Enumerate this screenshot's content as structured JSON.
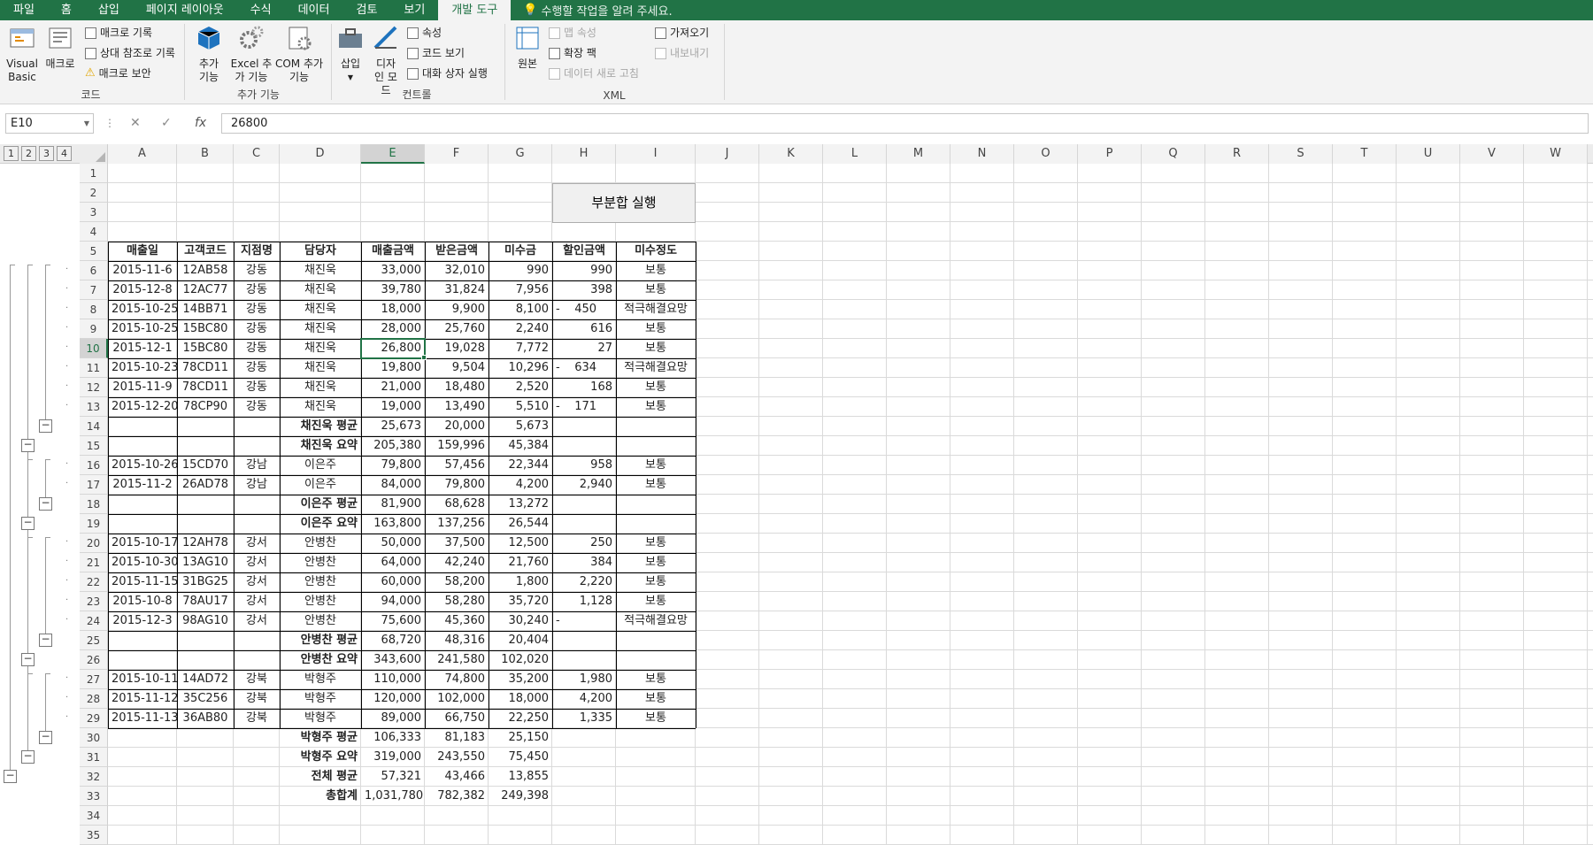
{
  "tabs": [
    "파일",
    "홈",
    "삽입",
    "페이지 레이아웃",
    "수식",
    "데이터",
    "검토",
    "보기",
    "개발 도구"
  ],
  "active_tab": "개발 도구",
  "tell_me": "수행할 작업을 알려 주세요.",
  "ribbon": {
    "code": {
      "label": "코드",
      "visual_basic": "Visual Basic",
      "macro": "매크로",
      "record_macro": "매크로 기록",
      "relative_ref": "상대 참조로 기록",
      "macro_security": "매크로 보안"
    },
    "addins": {
      "label": "추가 기능",
      "addins": "추가 기능",
      "excel_addins": "Excel 추가 기능",
      "com_addins": "COM 추가 기능"
    },
    "controls": {
      "label": "컨트롤",
      "insert": "삽입",
      "design_mode": "디자인 모드",
      "properties": "속성",
      "view_code": "코드 보기",
      "run_dialog": "대화 상자 실행"
    },
    "xml": {
      "label": "XML",
      "source": "원본",
      "map_props": "맵 속성",
      "expansion": "확장 팩",
      "refresh": "데이터 새로 고침",
      "import": "가져오기",
      "export": "내보내기"
    }
  },
  "name_box": "E10",
  "formula": "26800",
  "outline_levels": [
    "1",
    "2",
    "3",
    "4"
  ],
  "columns": [
    "A",
    "B",
    "C",
    "D",
    "E",
    "F",
    "G",
    "H",
    "I",
    "J",
    "K",
    "L",
    "M",
    "N",
    "O",
    "P",
    "Q",
    "R",
    "S",
    "T",
    "U",
    "V",
    "W"
  ],
  "rows": [
    "1",
    "2",
    "3",
    "4",
    "5",
    "6",
    "7",
    "8",
    "9",
    "10",
    "11",
    "12",
    "13",
    "14",
    "15",
    "16",
    "17",
    "18",
    "19",
    "20",
    "21",
    "22",
    "23",
    "24",
    "25",
    "26",
    "27",
    "28",
    "29",
    "30",
    "31",
    "32",
    "33",
    "34",
    "35"
  ],
  "button_label": "부분합 실행",
  "headers": [
    "매출일",
    "고객코드",
    "지점명",
    "담당자",
    "매출금액",
    "받은금액",
    "미수금",
    "할인금액",
    "미수정도"
  ],
  "data": [
    [
      "2015-11-6",
      "12AB58",
      "강동",
      "채진욱",
      "33,000",
      "32,010",
      "990",
      "990",
      "보통"
    ],
    [
      "2015-12-8",
      "12AC77",
      "강동",
      "채진욱",
      "39,780",
      "31,824",
      "7,956",
      "398",
      "보통"
    ],
    [
      "2015-10-25",
      "14BB71",
      "강동",
      "채진욱",
      "18,000",
      "9,900",
      "8,100",
      "-    450",
      "적극해결요망"
    ],
    [
      "2015-10-25",
      "15BC80",
      "강동",
      "채진욱",
      "28,000",
      "25,760",
      "2,240",
      "616",
      "보통"
    ],
    [
      "2015-12-1",
      "15BC80",
      "강동",
      "채진욱",
      "26,800",
      "19,028",
      "7,772",
      "27",
      "보통"
    ],
    [
      "2015-10-23",
      "78CD11",
      "강동",
      "채진욱",
      "19,800",
      "9,504",
      "10,296",
      "-    634",
      "적극해결요망"
    ],
    [
      "2015-11-9",
      "78CD11",
      "강동",
      "채진욱",
      "21,000",
      "18,480",
      "2,520",
      "168",
      "보통"
    ],
    [
      "2015-12-20",
      "78CP90",
      "강동",
      "채진욱",
      "19,000",
      "13,490",
      "5,510",
      "-    171",
      "보통"
    ],
    [
      "",
      "",
      "",
      "채진욱 평균",
      "25,673",
      "20,000",
      "5,673",
      "",
      ""
    ],
    [
      "",
      "",
      "",
      "채진욱 요약",
      "205,380",
      "159,996",
      "45,384",
      "",
      ""
    ],
    [
      "2015-10-26",
      "15CD70",
      "강남",
      "이은주",
      "79,800",
      "57,456",
      "22,344",
      "958",
      "보통"
    ],
    [
      "2015-11-2",
      "26AD78",
      "강남",
      "이은주",
      "84,000",
      "79,800",
      "4,200",
      "2,940",
      "보통"
    ],
    [
      "",
      "",
      "",
      "이은주 평균",
      "81,900",
      "68,628",
      "13,272",
      "",
      ""
    ],
    [
      "",
      "",
      "",
      "이은주 요약",
      "163,800",
      "137,256",
      "26,544",
      "",
      ""
    ],
    [
      "2015-10-17",
      "12AH78",
      "강서",
      "안병찬",
      "50,000",
      "37,500",
      "12,500",
      "250",
      "보통"
    ],
    [
      "2015-10-30",
      "13AG10",
      "강서",
      "안병찬",
      "64,000",
      "42,240",
      "21,760",
      "384",
      "보통"
    ],
    [
      "2015-11-15",
      "31BG25",
      "강서",
      "안병찬",
      "60,000",
      "58,200",
      "1,800",
      "2,220",
      "보통"
    ],
    [
      "2015-10-8",
      "78AU17",
      "강서",
      "안병찬",
      "94,000",
      "58,280",
      "35,720",
      "1,128",
      "보통"
    ],
    [
      "2015-12-3",
      "98AG10",
      "강서",
      "안병찬",
      "75,600",
      "45,360",
      "30,240",
      "-",
      "적극해결요망"
    ],
    [
      "",
      "",
      "",
      "안병찬 평균",
      "68,720",
      "48,316",
      "20,404",
      "",
      ""
    ],
    [
      "",
      "",
      "",
      "안병찬 요약",
      "343,600",
      "241,580",
      "102,020",
      "",
      ""
    ],
    [
      "2015-10-11",
      "14AD72",
      "강북",
      "박형주",
      "110,000",
      "74,800",
      "35,200",
      "1,980",
      "보통"
    ],
    [
      "2015-11-12",
      "35C256",
      "강북",
      "박형주",
      "120,000",
      "102,000",
      "18,000",
      "4,200",
      "보통"
    ],
    [
      "2015-11-13",
      "36AB80",
      "강북",
      "박형주",
      "89,000",
      "66,750",
      "22,250",
      "1,335",
      "보통"
    ],
    [
      "",
      "",
      "",
      "박형주 평균",
      "106,333",
      "81,183",
      "25,150",
      "",
      ""
    ],
    [
      "",
      "",
      "",
      "박형주 요약",
      "319,000",
      "243,550",
      "75,450",
      "",
      ""
    ],
    [
      "",
      "",
      "",
      "전체 평균",
      "57,321",
      "43,466",
      "13,855",
      "",
      ""
    ],
    [
      "",
      "",
      "",
      "총합계",
      "1,031,780",
      "782,382",
      "249,398",
      "",
      ""
    ]
  ]
}
